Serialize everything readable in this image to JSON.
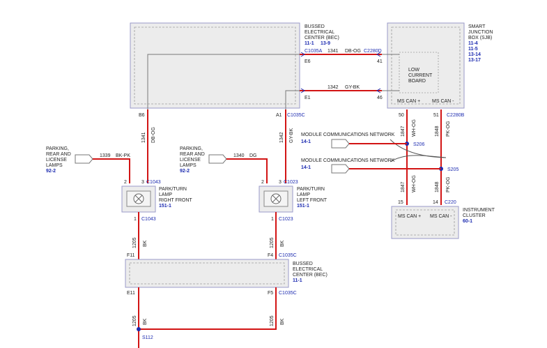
{
  "bec_top": {
    "title": [
      "BUSSED",
      "ELECTRICAL",
      "CENTER (BEC)"
    ],
    "ref1": "11-1",
    "ref2": "13-9"
  },
  "sjb": {
    "title": [
      "SMART",
      "JUNCTION",
      "BOX (SJB)"
    ],
    "refs": [
      "11-4",
      "11-5",
      "13-14",
      "13-17"
    ],
    "board": [
      "LOW",
      "CURRENT",
      "BOARD"
    ],
    "ms_can_plus": "MS CAN +",
    "ms_can_minus": "MS CAN -",
    "pin50": "50",
    "pin51": "51",
    "conn": "C2280B"
  },
  "wires": {
    "w1341_top": "1341",
    "w1341_color": "DB-OG",
    "w1342_top": "1342",
    "w1342_color": "GY-BK",
    "c1035a": "C1035A",
    "c2280d": "C2280D",
    "e6": "E6",
    "e1": "E1",
    "pin41": "41",
    "pin46": "46",
    "b6": "B6",
    "a1": "A1",
    "c1035c_top": "C1035C",
    "v1341": "1341",
    "v1341c": "DB-OG",
    "v1342": "1342",
    "v1342c": "GY-BK"
  },
  "left_lamps": {
    "label": [
      "PARKING,",
      "REAR AND",
      "LICENSE",
      "LAMPS"
    ],
    "ref": "92-2",
    "wire": "1339",
    "color": "BK-PK"
  },
  "mid_lamps": {
    "label": [
      "PARKING,",
      "REAR AND",
      "LICENSE",
      "LAMPS"
    ],
    "ref": "92-2",
    "wire": "1340",
    "color": "DG"
  },
  "lamp_rf": {
    "label": [
      "PARK/TURN",
      "LAMP",
      "RIGHT FRONT"
    ],
    "ref": "151-1",
    "pin2": "2",
    "pin3": "3",
    "conn": "C1043",
    "pin1": "1",
    "conn2": "C1043"
  },
  "lamp_lf": {
    "label": [
      "PARK/TURN",
      "LAMP",
      "LEFT FRONT"
    ],
    "ref": "151-1",
    "pin2": "2",
    "pin3": "3",
    "conn": "C1023",
    "pin1": "1",
    "conn2": "C1023"
  },
  "mcn1": {
    "label": "MODULE COMMUNICATIONS NETWORK",
    "ref": "14-1"
  },
  "mcn2": {
    "label": "MODULE COMMUNICATIONS NETWORK",
    "ref": "14-1"
  },
  "splices": {
    "s206": "S206",
    "s205": "S205",
    "s112": "S112"
  },
  "can_wires": {
    "w1847": "1847",
    "c1847": "WH-OG",
    "w1848": "1848",
    "c1848": "PK-OG"
  },
  "cluster": {
    "title": [
      "INSTRUMENT",
      "CLUSTER"
    ],
    "ref": "60-1",
    "pin15": "15",
    "pin14": "14",
    "conn": "C220",
    "ms_can_plus": "MS CAN +",
    "ms_can_minus": "MS CAN -"
  },
  "bec_bottom": {
    "title": [
      "BUSSED",
      "ELECTRICAL",
      "CENTER (BEC)"
    ],
    "ref": "11-1",
    "f11": "F11",
    "f4": "F4",
    "conn_top": "C1035C",
    "e11": "E11",
    "f5": "F5",
    "conn_bot": "C1035C"
  },
  "lower_wires": {
    "w1205a": "1205",
    "bk_a": "BK",
    "w1205b": "1205",
    "bk_b": "BK",
    "w1205c": "1205",
    "bk_c": "BK",
    "w1205d": "1205",
    "bk_d": "BK"
  }
}
